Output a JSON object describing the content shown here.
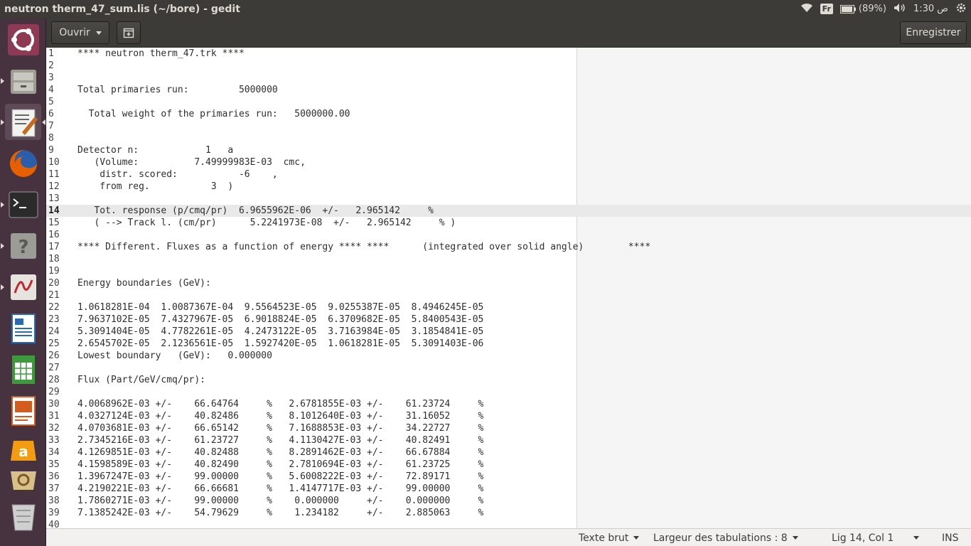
{
  "window": {
    "title": "neutron therm_47_sum.lis (~/bore) - gedit"
  },
  "indicators": {
    "keyboard": "Fr",
    "battery": "(89%)",
    "clock": "ص 1:30"
  },
  "toolbar": {
    "open_label": "Ouvrir",
    "save_label": "Enregistrer"
  },
  "launcher": {
    "items": [
      {
        "name": "ubuntu-dash-icon",
        "color": "#e95420"
      },
      {
        "name": "files-icon",
        "color": "#8a8a80"
      },
      {
        "name": "text-editor-icon",
        "color": "#d9d9d0"
      },
      {
        "name": "firefox-icon",
        "color": "#e66000"
      },
      {
        "name": "terminal-icon",
        "color": "#2b2b2b"
      },
      {
        "name": "help-icon",
        "color": "#9c9c96"
      },
      {
        "name": "document-viewer-icon",
        "color": "#e7e4df"
      },
      {
        "name": "writer-icon",
        "color": "#2a6ab5"
      },
      {
        "name": "calc-icon",
        "color": "#3c9a3c"
      },
      {
        "name": "impress-icon",
        "color": "#d35c1e"
      },
      {
        "name": "amazon-icon",
        "color": "#f39c12"
      },
      {
        "name": "software-center-icon",
        "color": "#d8c08a"
      },
      {
        "name": "trash-icon",
        "color": "#cfcfcf"
      }
    ]
  },
  "editor": {
    "current_line": 14,
    "lines": [
      "**** neutron therm_47.trk ****",
      "",
      "",
      "Total primaries run:         5000000",
      "",
      "  Total weight of the primaries run:   5000000.00",
      "",
      "",
      "Detector n:            1   a",
      "   (Volume:          7.49999983E-03  cmc,",
      "    distr. scored:           -6    ,",
      "    from reg.           3  )",
      "",
      "   Tot. response (p/cmq/pr)  6.9655962E-06  +/-   2.965142     %",
      "   ( --> Track l. (cm/pr)      5.2241973E-08  +/-   2.965142     % )",
      "",
      "**** Different. Fluxes as a function of energy **** ****      (integrated over solid angle)        ****",
      "",
      "",
      "Energy boundaries (GeV):",
      "",
      "1.0618281E-04  1.0087367E-04  9.5564523E-05  9.0255387E-05  8.4946245E-05",
      "7.9637102E-05  7.4327967E-05  6.9018824E-05  6.3709682E-05  5.8400543E-05",
      "5.3091404E-05  4.7782261E-05  4.2473122E-05  3.7163984E-05  3.1854841E-05",
      "2.6545702E-05  2.1236561E-05  1.5927420E-05  1.0618281E-05  5.3091403E-06",
      "Lowest boundary   (GeV):   0.000000",
      "",
      "Flux (Part/GeV/cmq/pr):",
      "",
      "4.0068962E-03 +/-    66.64764     %   2.6781855E-03 +/-    61.23724     %",
      "4.0327124E-03 +/-    40.82486     %   8.1012640E-03 +/-    31.16052     %",
      "4.0703681E-03 +/-    66.65142     %   7.1688853E-03 +/-    34.22727     %",
      "2.7345216E-03 +/-    61.23727     %   4.1130427E-03 +/-    40.82491     %",
      "4.1269851E-03 +/-    40.82488     %   8.2891462E-03 +/-    66.67884     %",
      "4.1598589E-03 +/-    40.82490     %   2.7810694E-03 +/-    61.23725     %",
      "1.3967247E-03 +/-    99.00000     %   5.6008222E-03 +/-    72.89171     %",
      "4.2190221E-03 +/-    66.66681     %   1.4147717E-03 +/-    99.00000     %",
      "1.7860271E-03 +/-    99.00000     %    0.000000     +/-    0.000000     %",
      "7.1385242E-03 +/-    54.79629     %    1.234182     +/-    2.885063     %",
      ""
    ]
  },
  "statusbar": {
    "syntax": "Texte brut",
    "tab_width": "Largeur des tabulations : 8",
    "position": "Lig 14, Col 1",
    "mode": "INS"
  }
}
